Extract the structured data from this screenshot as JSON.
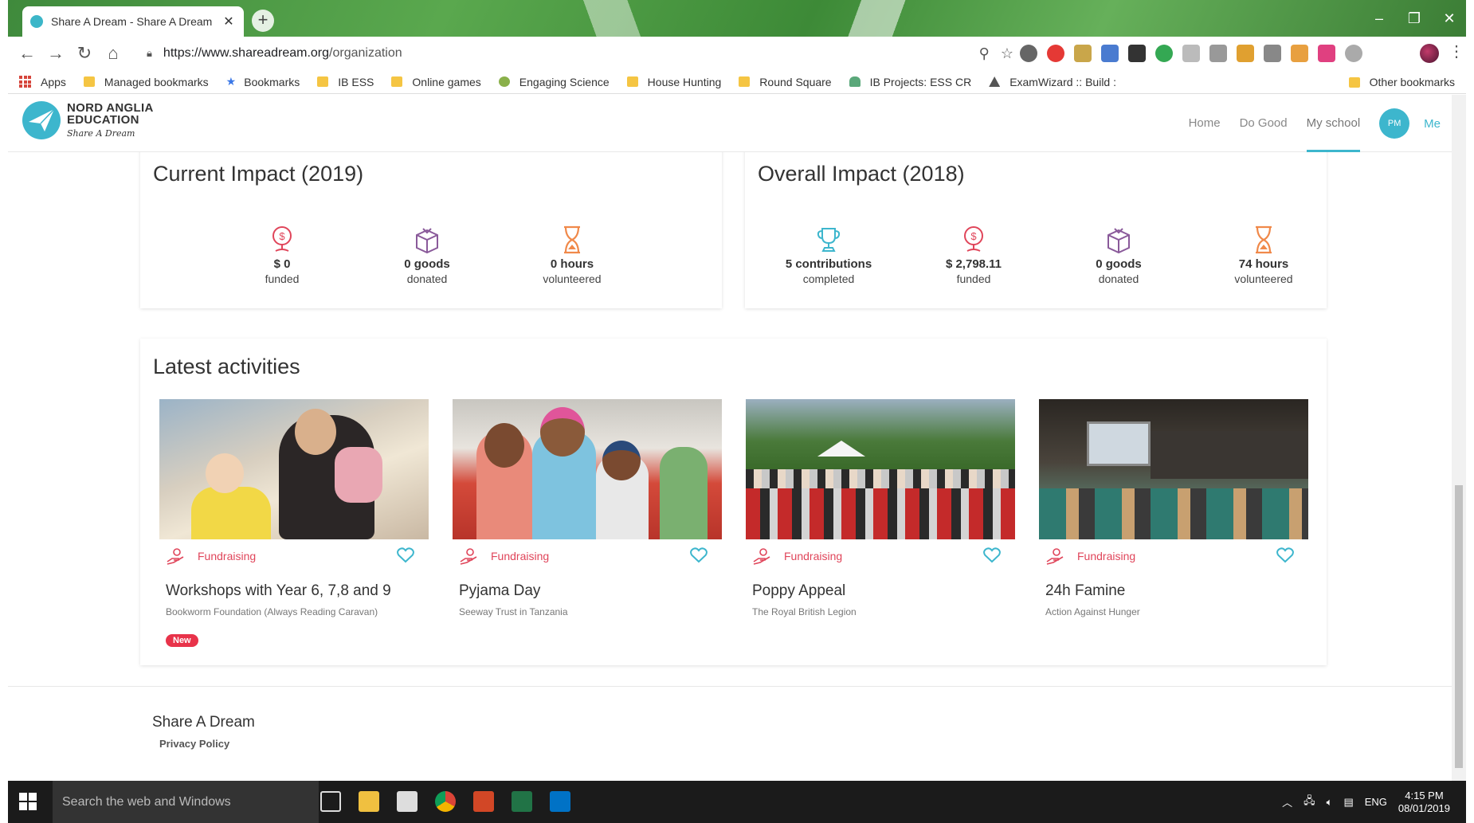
{
  "browser": {
    "tab_title": "Share A Dream - Share A Dream",
    "url_host": "https://www.shareadream.org",
    "url_path": "/organization",
    "bookmarks": [
      {
        "label": "Apps",
        "icon": "apps-grid-icon"
      },
      {
        "label": "Managed bookmarks",
        "icon": "folder-icon"
      },
      {
        "label": "Bookmarks",
        "icon": "star-icon"
      },
      {
        "label": "IB ESS",
        "icon": "folder-icon"
      },
      {
        "label": "Online games",
        "icon": "folder-icon"
      },
      {
        "label": "Engaging Science",
        "icon": "leaf-icon"
      },
      {
        "label": "House Hunting",
        "icon": "folder-icon"
      },
      {
        "label": "Round Square",
        "icon": "folder-icon"
      },
      {
        "label": "IB Projects: ESS CR",
        "icon": "cloud-icon"
      },
      {
        "label": "ExamWizard :: Build :",
        "icon": "wizard-icon"
      }
    ],
    "other_bookmarks": "Other bookmarks"
  },
  "site": {
    "logo_line1": "NORD ANGLIA",
    "logo_line2": "EDUCATION",
    "logo_tagline": "Share A Dream",
    "nav": {
      "home": "Home",
      "do_good": "Do Good",
      "my_school": "My school",
      "avatar_initials": "PM",
      "me": "Me"
    },
    "accent_color": "#3db6cd",
    "brand_red": "#e0455a"
  },
  "current_impact": {
    "title": "Current Impact (2019)",
    "stats": [
      {
        "value": "$ 0",
        "label": "funded",
        "icon": "money-bag-icon"
      },
      {
        "value": "0 goods",
        "label": "donated",
        "icon": "gift-box-icon"
      },
      {
        "value": "0 hours",
        "label": "volunteered",
        "icon": "hourglass-icon"
      }
    ]
  },
  "overall_impact": {
    "title": "Overall Impact (2018)",
    "stats": [
      {
        "value": "5 contributions",
        "label": "completed",
        "icon": "trophy-icon"
      },
      {
        "value": "$ 2,798.11",
        "label": "funded",
        "icon": "money-bag-icon"
      },
      {
        "value": "0 goods",
        "label": "donated",
        "icon": "gift-box-icon"
      },
      {
        "value": "74 hours",
        "label": "volunteered",
        "icon": "hourglass-icon"
      }
    ]
  },
  "activities": {
    "title": "Latest activities",
    "items": [
      {
        "category": "Fundraising",
        "name": "Workshops with Year 6, 7,8 and 9",
        "org": "Bookworm Foundation (Always Reading Caravan)",
        "badge": "New"
      },
      {
        "category": "Fundraising",
        "name": "Pyjama Day",
        "org": "Seeway Trust in Tanzania"
      },
      {
        "category": "Fundraising",
        "name": "Poppy Appeal",
        "org": "The Royal British Legion"
      },
      {
        "category": "Fundraising",
        "name": "24h Famine",
        "org": "Action Against Hunger"
      }
    ]
  },
  "footer": {
    "title": "Share A Dream",
    "privacy": "Privacy Policy"
  },
  "taskbar": {
    "search_placeholder": "Search the web and Windows",
    "lang": "ENG",
    "time": "4:15 PM",
    "date": "08/01/2019"
  }
}
